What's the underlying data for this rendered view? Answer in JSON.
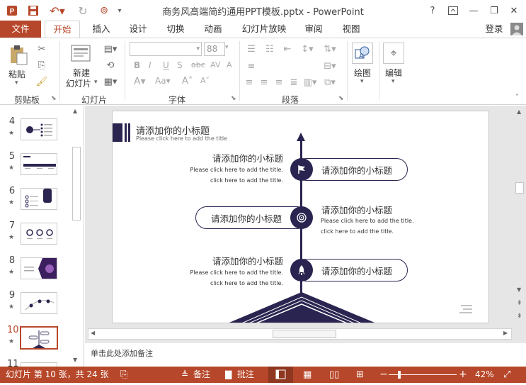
{
  "window": {
    "title": "商务风高端简约通用PPT模板.pptx - PowerPoint",
    "help": "?",
    "account": "登录"
  },
  "tabs": [
    "文件",
    "开始",
    "插入",
    "设计",
    "切换",
    "动画",
    "幻灯片放映",
    "审阅",
    "视图"
  ],
  "ribbon": {
    "paste_label": "粘贴",
    "new_slide_label_1": "新建",
    "new_slide_label_2": "幻灯片",
    "font_size": "88",
    "draw_label": "绘图",
    "edit_label": "编辑",
    "groups": [
      "剪贴板",
      "幻灯片",
      "字体",
      "段落"
    ]
  },
  "slides": [
    {
      "num": "4",
      "star": "★"
    },
    {
      "num": "5",
      "star": "★"
    },
    {
      "num": "6",
      "star": "★"
    },
    {
      "num": "7",
      "star": "★"
    },
    {
      "num": "8",
      "star": "★"
    },
    {
      "num": "9",
      "star": "★"
    },
    {
      "num": "10",
      "star": "★",
      "selected": true
    },
    {
      "num": "11",
      "star": ""
    }
  ],
  "slide": {
    "title": "请添加你的小标题",
    "title_sub": "Please click here to add the title",
    "items": [
      {
        "left_title": "请添加你的小标题",
        "left_line1": "Please click here to add the title.",
        "left_line2": "click here to add the title.",
        "pill": "请添加你的小标题",
        "icon": "flag-icon"
      },
      {
        "pill": "请添加你的小标题",
        "right_title": "请添加你的小标题",
        "right_line1": "Please click here to add the title.",
        "right_line2": "click here to add the title.",
        "icon": "target-icon"
      },
      {
        "left_title": "请添加你的小标题",
        "left_line1": "Please click here to add the title.",
        "left_line2": "click here to add the title.",
        "pill": "请添加你的小标题",
        "icon": "rocket-icon"
      }
    ],
    "accent": "#2a2550"
  },
  "notes_placeholder": "单击此处添加备注",
  "status": {
    "slide_info": "幻灯片 第 10 张，共 24 张",
    "notes_btn": "备注",
    "comments_btn": "批注",
    "zoom": "42%"
  },
  "colors": {
    "brand": "#b7472a"
  }
}
